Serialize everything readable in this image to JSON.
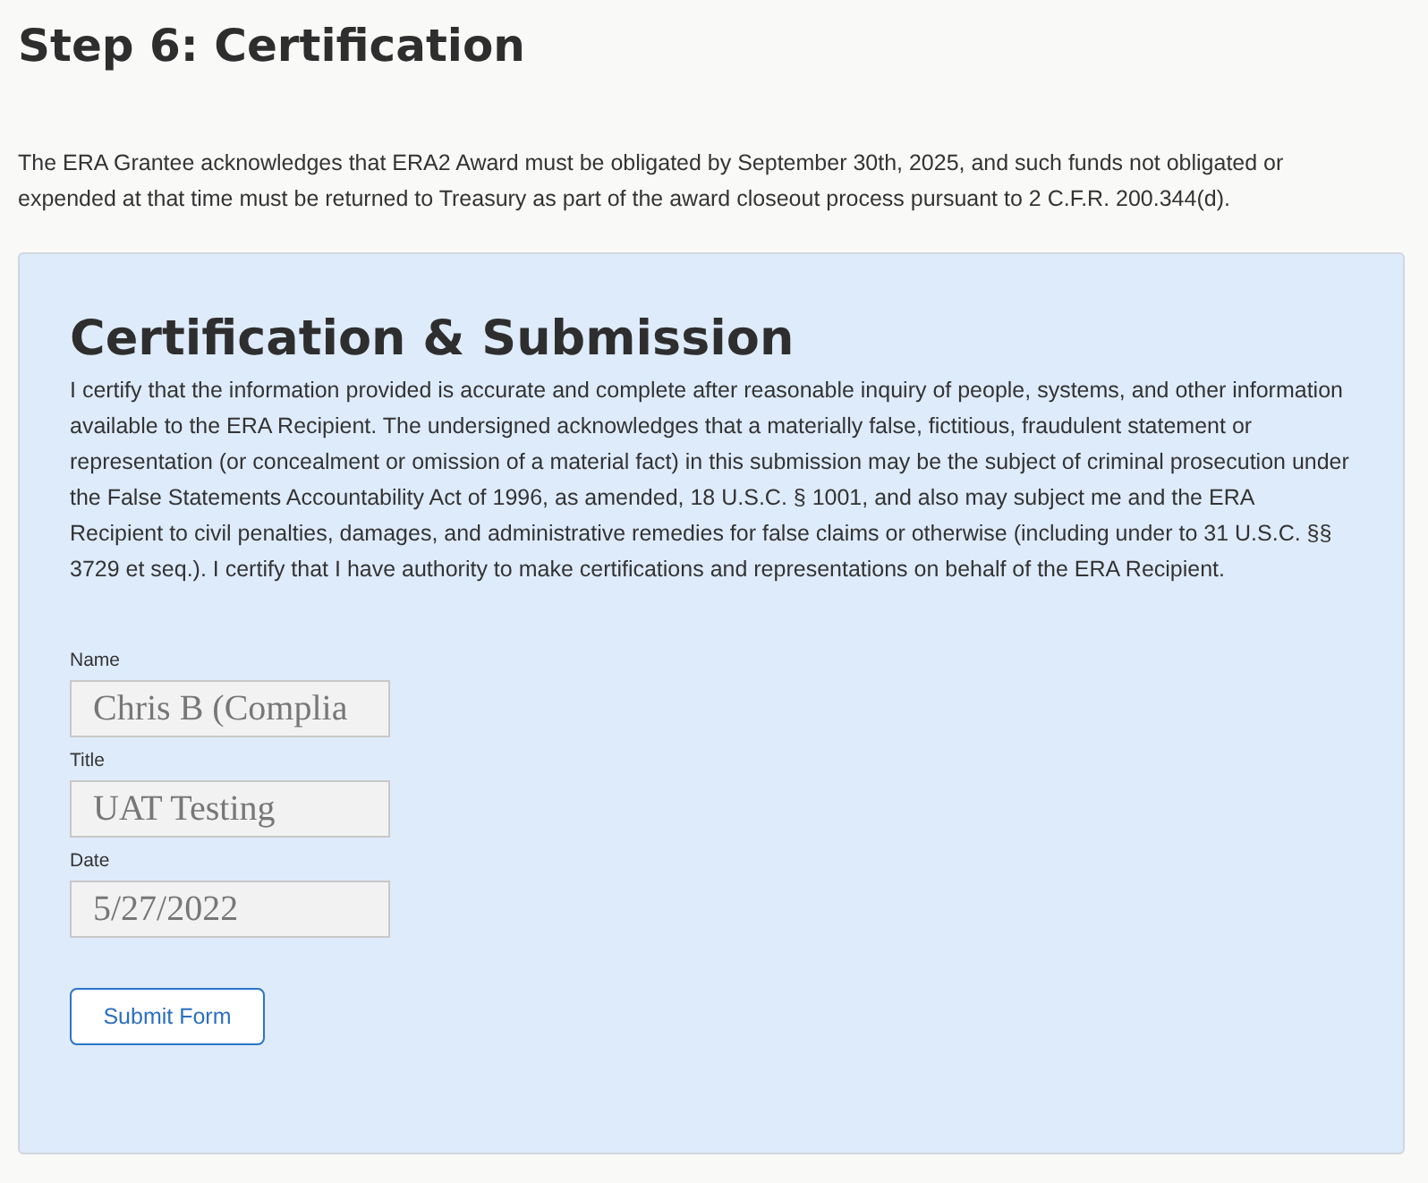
{
  "page_title": "Step 6: Certification",
  "notice": "The ERA Grantee acknowledges that ERA2 Award must be obligated by September 30th, 2025, and such funds not obligated or expended at that time must be returned to Treasury as part of the award closeout process pursuant to 2 C.F.R. 200.344(d).",
  "card": {
    "title": "Certification & Submission",
    "statement": "I certify that the information provided is accurate and complete after reasonable inquiry of people, systems, and other information available to the ERA Recipient. The undersigned acknowledges that a materially false, fictitious, fraudulent statement or representation (or concealment or omission of a material fact) in this submission may be the subject of criminal prosecution under the False Statements Accountability Act of 1996, as amended, 18 U.S.C. § 1001, and also may subject me and the ERA Recipient to civil penalties, damages, and administrative remedies for false claims or otherwise (including under to 31 U.S.C. §§ 3729 et seq.). I certify that I have authority to make certifications and representations on behalf of the ERA Recipient.",
    "fields": [
      {
        "label": "Name",
        "value": "Chris B (Complia",
        "disabled": true
      },
      {
        "label": "Title",
        "value": "UAT Testing",
        "disabled": true
      },
      {
        "label": "Date",
        "value": "5/27/2022",
        "disabled": true
      }
    ],
    "submit_button": "Submit Form"
  }
}
